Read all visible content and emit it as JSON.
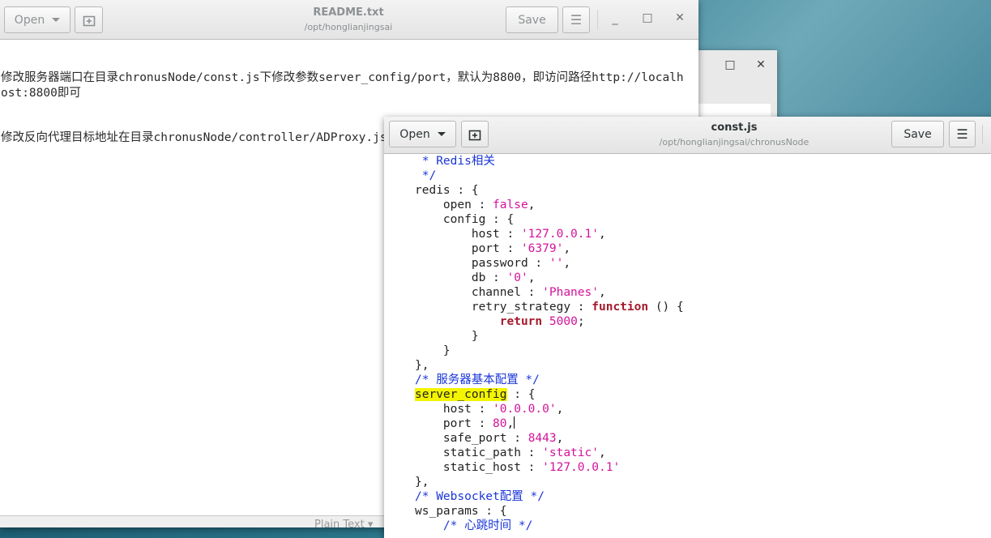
{
  "background_window": {
    "controls": {
      "maximize": "□",
      "close": "✕"
    }
  },
  "readme_window": {
    "title": "README.txt",
    "path": "/opt/honglianjingsai",
    "open_label": "Open",
    "save_label": "Save",
    "menu_icon": "☰",
    "controls": {
      "minimize": "_",
      "maximize": "□",
      "close": "✕"
    },
    "lines": [
      "修改服务器端口在目录chronusNode/const.js下修改参数server_config/port，默认为8800，即访问路径http://localhost:8800即可",
      "修改反向代理目标地址在目录chronusNode/controller/ADProxy.js下修改函数service即可"
    ],
    "status": "Plain Text ▾"
  },
  "const_window": {
    "title": "const.js",
    "path": "/opt/honglianjingsai/chronusNode",
    "open_label": "Open",
    "save_label": "Save",
    "menu_icon": "☰"
  },
  "code": {
    "l1_comment": " * Redis相关",
    "l2_comment": " */",
    "l3_key": "redis : {",
    "l4_key": "    open : ",
    "l4_val": "false",
    "l4_end": ",",
    "l5_key": "    config : {",
    "l6_key": "        host : ",
    "l6_val": "'127.0.0.1'",
    "l6_end": ",",
    "l7_key": "        port : ",
    "l7_val": "'6379'",
    "l7_end": ",",
    "l8_key": "        password : ",
    "l8_val": "''",
    "l8_end": ",",
    "l9_key": "        db : ",
    "l9_val": "'0'",
    "l9_end": ",",
    "l10_key": "        channel : ",
    "l10_val": "'Phanes'",
    "l10_end": ",",
    "l11_key": "        retry_strategy : ",
    "l11_kw": "function",
    "l11_end": " () {",
    "l12_indent": "            ",
    "l12_kw": "return",
    "l12_sp": " ",
    "l12_val": "5000",
    "l12_end": ";",
    "l13": "        }",
    "l14": "    }",
    "l15": "},",
    "l16_comment": "/* 服务器基本配置 */",
    "l17_hl": "server_config",
    "l17_end": " : {",
    "l18_key": "    host : ",
    "l18_val": "'0.0.0.0'",
    "l18_end": ",",
    "l19_key": "    port : ",
    "l19_val": "80",
    "l19_end": ",",
    "l20_key": "    safe_port : ",
    "l20_val": "8443",
    "l20_end": ",",
    "l21_key": "    static_path : ",
    "l21_val": "'static'",
    "l21_end": ",",
    "l22_key": "    static_host : ",
    "l22_val": "'127.0.0.1'",
    "l23": "},",
    "l24_comment": "/* Websocket配置 */",
    "l25_key": "ws_params : {",
    "l26_comment": "    /* 心跳时间 */"
  }
}
